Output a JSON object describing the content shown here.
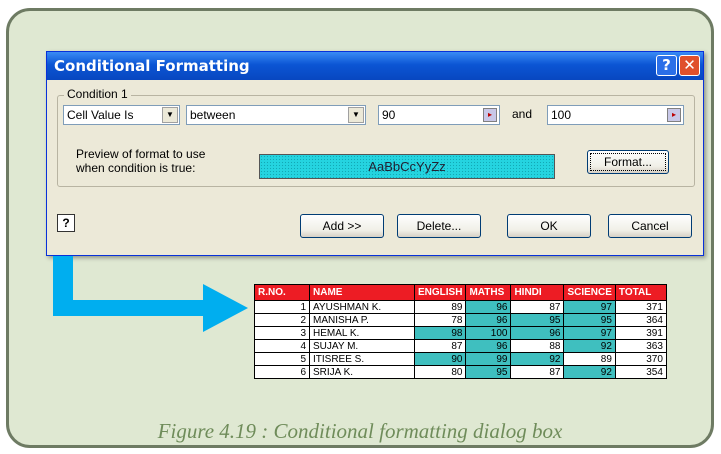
{
  "colors": {
    "frame_bg": "#dfe8d2",
    "title_bar": "#0b55d4",
    "header_red": "#ed1c24",
    "highlight": "#3fbfbf",
    "arrow": "#00aeef"
  },
  "dialog": {
    "title": "Conditional Formatting",
    "help_glyph": "?",
    "close_glyph": "✕",
    "condition_label": "Condition 1",
    "type_select": "Cell Value Is",
    "operator_select": "between",
    "value1": "90",
    "and_label": "and",
    "value2": "100",
    "preview_label_line1": "Preview of format to use",
    "preview_label_line2": "when condition is true:",
    "preview_text": "AaBbCcYyZz",
    "format_button": "Format...",
    "add_button": "Add >>",
    "delete_button": "Delete...",
    "ok_button": "OK",
    "cancel_button": "Cancel",
    "help_icon": "question-icon"
  },
  "table": {
    "headers": [
      "R.NO.",
      "NAME",
      "ENGLISH",
      "MATHS",
      "HINDI",
      "SCIENCE",
      "TOTAL"
    ],
    "rows": [
      [
        "1",
        "AYUSHMAN K.",
        "89",
        "96",
        "87",
        "97",
        "371"
      ],
      [
        "2",
        "MANISHA P.",
        "78",
        "96",
        "95",
        "95",
        "364"
      ],
      [
        "3",
        "HEMAL K.",
        "98",
        "100",
        "96",
        "97",
        "391"
      ],
      [
        "4",
        "SUJAY M.",
        "87",
        "96",
        "88",
        "92",
        "363"
      ],
      [
        "5",
        "ITISREE S.",
        "90",
        "99",
        "92",
        "89",
        "370"
      ],
      [
        "6",
        "SRIJA K.",
        "80",
        "95",
        "87",
        "92",
        "354"
      ]
    ]
  },
  "caption": "Figure 4.19 : Conditional formatting dialog box"
}
